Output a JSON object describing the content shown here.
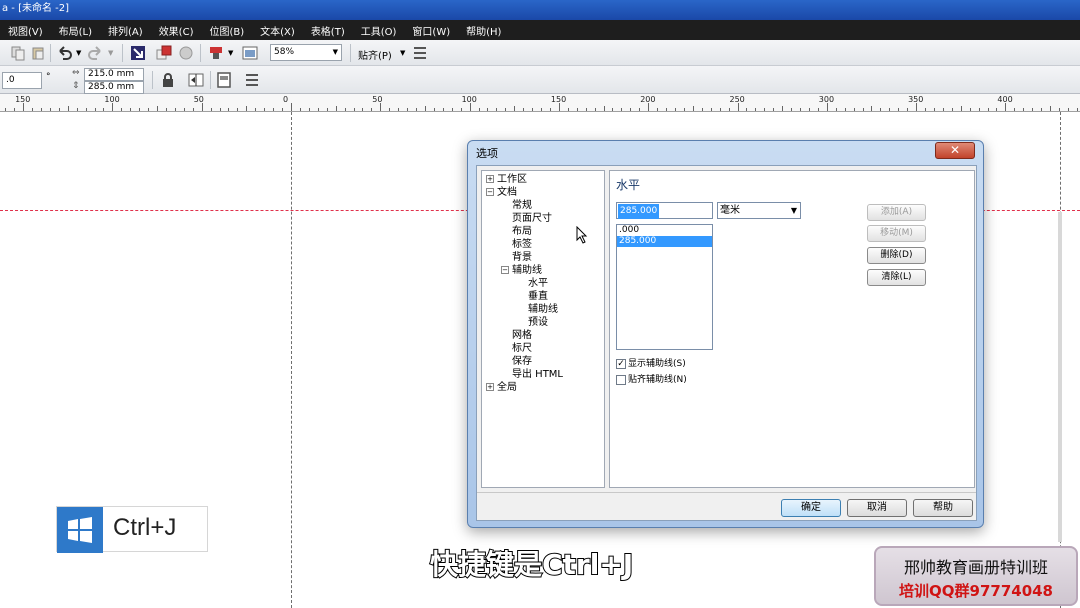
{
  "window": {
    "title": "a - [未命名 -2]"
  },
  "menu": [
    "视图(V)",
    "布局(L)",
    "排列(A)",
    "效果(C)",
    "位图(B)",
    "文本(X)",
    "表格(T)",
    "工具(O)",
    "窗口(W)",
    "帮助(H)"
  ],
  "toolbar1": {
    "zoom": "58%",
    "snap": "贴齐(P)"
  },
  "toolbar2": {
    "angle": ".0",
    "angle_unit": "°",
    "width": "215.0 mm",
    "height": "285.0 mm"
  },
  "ruler": {
    "labels": [
      "150",
      "100",
      "50",
      "0",
      "50",
      "100",
      "150",
      "200",
      "250",
      "300",
      "350",
      "400"
    ]
  },
  "dialog": {
    "title": "选项",
    "close": "✕",
    "tree": {
      "workspace": "工作区",
      "document": "文档",
      "general": "常规",
      "page_size": "页面尺寸",
      "layout": "布局",
      "label": "标签",
      "background": "背景",
      "guidelines": "辅助线",
      "horizontal": "水平",
      "vertical": "垂直",
      "guides": "辅助线",
      "presets": "预设",
      "grid": "网格",
      "rulers": "标尺",
      "save": "保存",
      "export_html": "导出 HTML",
      "global": "全局"
    },
    "panel": {
      "title": "水平",
      "input_value": "285.000",
      "unit": "毫米",
      "list": [
        ".000",
        "285.000"
      ],
      "add": "添加(A)",
      "move": "移动(M)",
      "delete": "删除(D)",
      "clear": "清除(L)",
      "show_guides": "显示辅助线(S)",
      "snap_guides": "贴齐辅助线(N)"
    },
    "ok": "确定",
    "cancel": "取消",
    "help": "帮助"
  },
  "overlay": {
    "shortcut": "Ctrl+J",
    "subtitle": "快捷键是Ctrl+J",
    "brand_line1": "邢帅教育画册特训班",
    "brand_line2": "培训QQ群97774048"
  }
}
